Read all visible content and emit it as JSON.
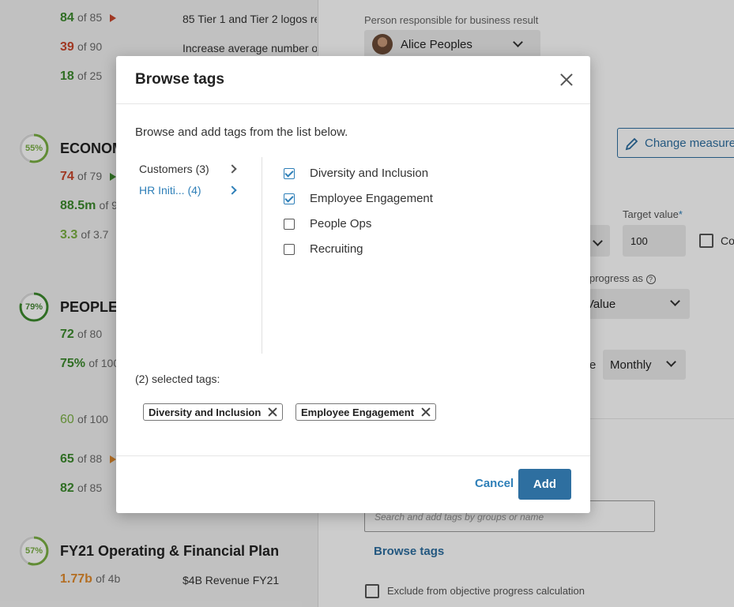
{
  "background_left": {
    "rows": [
      {
        "value": "84",
        "of": "of 85",
        "desc": "85 Tier 1 and Tier 2 logos re"
      },
      {
        "value": "39",
        "of": "of 90",
        "desc": "Increase average number of"
      },
      {
        "value": "18",
        "of": "of 25",
        "desc": ""
      },
      {
        "value": "74",
        "of": "of 79"
      },
      {
        "value": "88.5m",
        "of": "of 9"
      },
      {
        "value": "3.3",
        "of": "of 3.7"
      },
      {
        "value": "72",
        "of": "of 80"
      },
      {
        "value": "75%",
        "of": "of 100"
      },
      {
        "value": "60",
        "of": "of 100"
      },
      {
        "value": "65",
        "of": "of 88"
      },
      {
        "value": "82",
        "of": "of 85"
      },
      {
        "value": "1.77b",
        "of": "of 4b",
        "desc": "$4B Revenue FY21"
      }
    ],
    "objectives": [
      {
        "percent": "55%",
        "title": "ECONOM"
      },
      {
        "percent": "79%",
        "title": "PEOPLE"
      },
      {
        "percent": "57%",
        "title": "FY21 Operating & Financial Plan"
      }
    ]
  },
  "background_right": {
    "person_label": "Person responsible for business result",
    "person_name": "Alice Peoples",
    "change_button": "Change measurem",
    "target_label": "Target value",
    "target_required": "*",
    "target_value": "100",
    "checkbox_label": "Co",
    "progress_label": "progress as",
    "progress_value": "Value",
    "frequency_suffix": "e",
    "frequency_value": "Monthly",
    "search_placeholder": "Search and add tags by groups or name",
    "browse_tags_link": "Browse tags",
    "exclude_label": "Exclude from objective progress calculation"
  },
  "modal": {
    "title": "Browse tags",
    "instructions": "Browse and add tags from the list below.",
    "groups": [
      {
        "label": "Customers (3)",
        "active": false
      },
      {
        "label": "HR Initi... (4)",
        "active": true
      }
    ],
    "tags": [
      {
        "label": "Diversity and Inclusion",
        "checked": true
      },
      {
        "label": "Employee Engagement",
        "checked": true
      },
      {
        "label": "People Ops",
        "checked": false
      },
      {
        "label": "Recruiting",
        "checked": false
      }
    ],
    "selected_count_label": "(2) selected tags:",
    "selected_tags": [
      "Diversity and Inclusion",
      "Employee Engagement"
    ],
    "cancel_label": "Cancel",
    "add_label": "Add"
  },
  "colors": {
    "accent": "#2e6fa0",
    "link": "#2e7fb8",
    "green": "#3c8a2e",
    "red": "#c9472c"
  }
}
